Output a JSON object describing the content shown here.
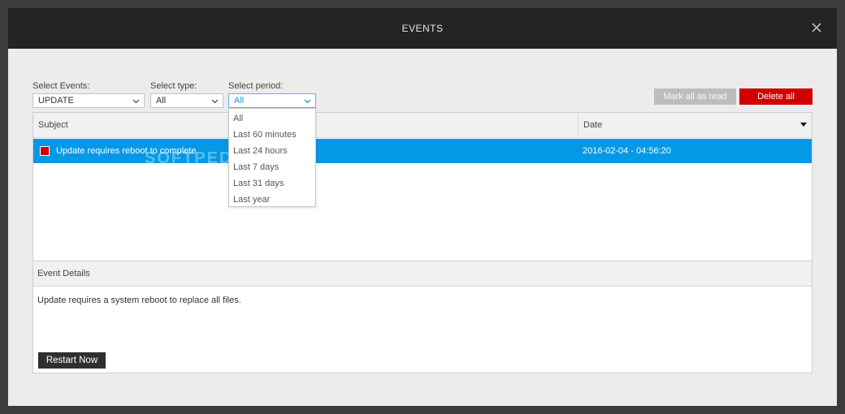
{
  "window": {
    "title": "EVENTS"
  },
  "filters": {
    "events_label": "Select Events:",
    "events_value": "UPDATE",
    "type_label": "Select type:",
    "type_value": "All",
    "period_label": "Select period:",
    "period_value": "All",
    "period_options": [
      "All",
      "Last 60 minutes",
      "Last 24 hours",
      "Last 7 days",
      "Last 31 days",
      "Last year"
    ]
  },
  "actions": {
    "mark_all_read": "Mark all as read",
    "delete_all": "Delete all"
  },
  "table": {
    "col_subject": "Subject",
    "col_date": "Date",
    "rows": [
      {
        "subject": "Update requires reboot to complete",
        "date": "2016-02-04 - 04:56:20"
      }
    ]
  },
  "details": {
    "header": "Event Details",
    "text": "Update requires a system reboot to replace all files.",
    "restart_label": "Restart Now"
  },
  "watermark": "SOFTPEDIA",
  "colors": {
    "accent_blue": "#0399e6",
    "danger_red": "#d00000",
    "titlebar": "#232323"
  }
}
